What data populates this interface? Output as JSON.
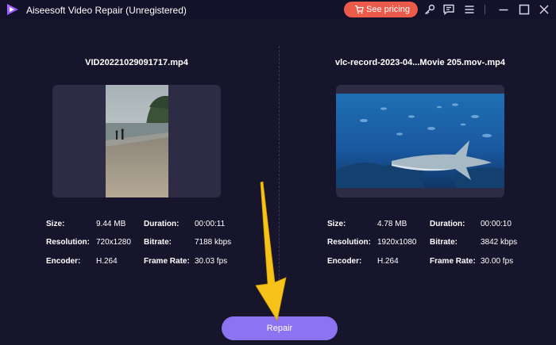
{
  "app": {
    "title": "Aiseesoft Video Repair (Unregistered)",
    "pricing_label": "See pricing",
    "accent": "#8b73f2",
    "pricing_color": "#ec5a4a",
    "toolbar_icons": [
      "key-icon",
      "chat-icon",
      "menu-icon",
      "minimize-icon",
      "maximize-icon",
      "close-icon"
    ]
  },
  "left_video": {
    "file_name": "VID20221029091717.mp4",
    "size_label": "Size:",
    "size": "9.44 MB",
    "resolution_label": "Resolution:",
    "resolution": "720x1280",
    "encoder_label": "Encoder:",
    "encoder": "H.264",
    "duration_label": "Duration:",
    "duration": "00:00:11",
    "bitrate_label": "Bitrate:",
    "bitrate": "7188 kbps",
    "frame_rate_label": "Frame Rate:",
    "frame_rate": "30.03 fps"
  },
  "right_video": {
    "file_name": "vlc-record-2023-04...Movie 205.mov-.mp4",
    "size_label": "Size:",
    "size": "4.78 MB",
    "resolution_label": "Resolution:",
    "resolution": "1920x1080",
    "encoder_label": "Encoder:",
    "encoder": "H.264",
    "duration_label": "Duration:",
    "duration": "00:00:10",
    "bitrate_label": "Bitrate:",
    "bitrate": "3842 kbps",
    "frame_rate_label": "Frame Rate:",
    "frame_rate": "30.00 fps"
  },
  "repair_button_label": "Repair"
}
